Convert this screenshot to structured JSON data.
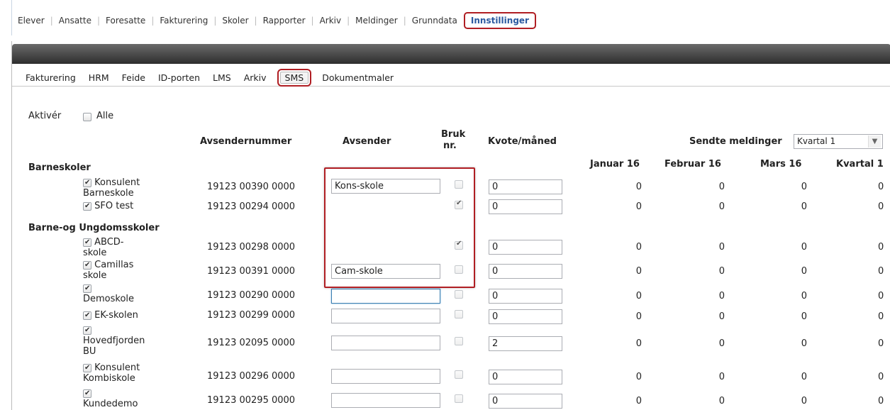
{
  "top_nav": {
    "items": [
      "Elever",
      "Ansatte",
      "Foresatte",
      "Fakturering",
      "Skoler",
      "Rapporter",
      "Arkiv",
      "Meldinger",
      "Grunndata",
      "Innstillinger"
    ],
    "active": "Innstillinger"
  },
  "sub_nav": {
    "tabs": [
      "Fakturering",
      "HRM",
      "Feide",
      "ID-porten",
      "LMS",
      "Arkiv",
      "SMS",
      "Dokumentmaler"
    ],
    "active": "SMS"
  },
  "activate": {
    "label": "Aktivér",
    "all_label": "Alle"
  },
  "columns": {
    "sender_number": "Avsendernummer",
    "sender": "Avsender",
    "use_nr_line1": "Bruk",
    "use_nr_line2": "nr.",
    "quota": "Kvote/måned",
    "sent_messages": "Sendte meldinger",
    "period_select": "Kvartal 1",
    "months": [
      "Januar 16",
      "Februar 16",
      "Mars 16",
      "Kvartal 1"
    ]
  },
  "groups": [
    {
      "name": "Barneskoler"
    },
    {
      "name": "Barne-og Ungdomsskoler"
    }
  ],
  "rows": [
    {
      "name_lines": [
        "Konsulent",
        "Barneskole"
      ],
      "number": "19123 00390 0000",
      "sender": "Kons-skole",
      "use_nr": false,
      "quota": "0",
      "sent": [
        "0",
        "0",
        "0",
        "0"
      ]
    },
    {
      "name_lines": [
        "SFO test"
      ],
      "number": "19123 00294 0000",
      "sender": "",
      "use_nr": true,
      "quota": "0",
      "sent": [
        "0",
        "0",
        "0",
        "0"
      ]
    },
    {
      "name_lines": [
        "ABCD-",
        "skole"
      ],
      "number": "19123 00298 0000",
      "sender": "",
      "use_nr": true,
      "quota": "0",
      "sent": [
        "0",
        "0",
        "0",
        "0"
      ]
    },
    {
      "name_lines": [
        "Camillas",
        "skole"
      ],
      "number": "19123 00391 0000",
      "sender": "Cam-skole",
      "use_nr": false,
      "quota": "0",
      "sent": [
        "0",
        "0",
        "0",
        "0"
      ]
    },
    {
      "name_lines": [
        "",
        "Demoskole"
      ],
      "number": "19123 00290 0000",
      "sender": "",
      "use_nr": false,
      "quota": "0",
      "sent": [
        "0",
        "0",
        "0",
        "0"
      ]
    },
    {
      "name_lines": [
        "EK-skolen"
      ],
      "number": "19123 00299 0000",
      "sender": "",
      "use_nr": false,
      "quota": "0",
      "sent": [
        "0",
        "0",
        "0",
        "0"
      ]
    },
    {
      "name_lines": [
        "",
        "Hovedfjorden",
        "BU"
      ],
      "number": "19123 02095 0000",
      "sender": "",
      "use_nr": false,
      "quota": "2",
      "sent": [
        "0",
        "0",
        "0",
        "0"
      ]
    },
    {
      "name_lines": [
        "Konsulent",
        "Kombiskole"
      ],
      "number": "19123 00296 0000",
      "sender": "",
      "use_nr": false,
      "quota": "0",
      "sent": [
        "0",
        "0",
        "0",
        "0"
      ]
    },
    {
      "name_lines": [
        "",
        "Kundedemo"
      ],
      "number": "19123 00295 0000",
      "sender": "",
      "use_nr": false,
      "quota": "0",
      "sent": [
        "0",
        "0",
        "0",
        "0"
      ]
    }
  ]
}
